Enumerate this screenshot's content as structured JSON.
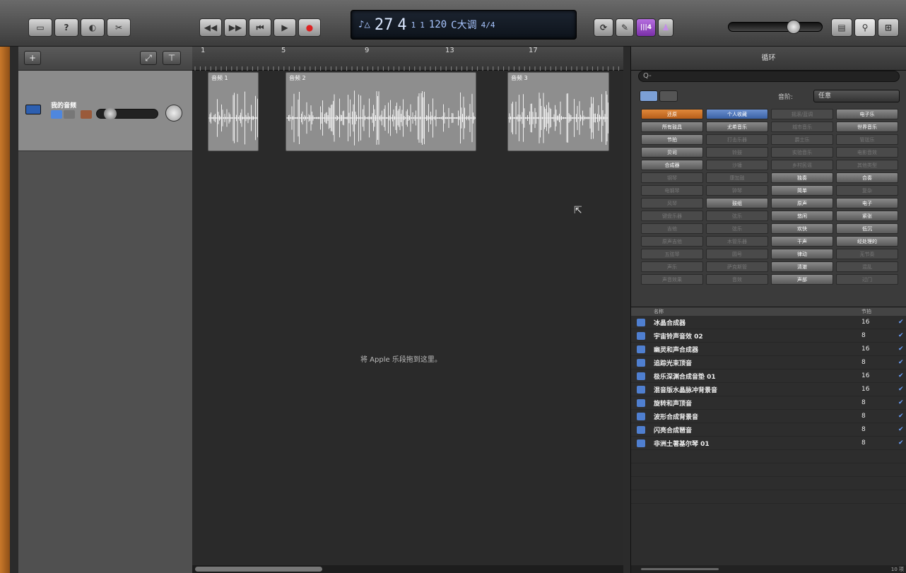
{
  "toolbar": {
    "left_buttons": [
      "▭",
      "?",
      "◐",
      "✂"
    ],
    "transport_buttons": [
      "◀◀",
      "▶▶",
      "⏮",
      "▶",
      "●"
    ],
    "lcd": {
      "bar": "27",
      "beat": "4",
      "div": "1",
      "tick": "1",
      "tempo": "120",
      "key": "C大调",
      "sig": "4/4"
    },
    "right_tools": [
      "⟳",
      "✎",
      "|||4",
      "♟"
    ],
    "right_buttons": [
      "▤",
      "⚲",
      "⊞"
    ]
  },
  "tracks": {
    "track_name": "我的音频"
  },
  "ruler": {
    "ticks": [
      "1",
      "5",
      "9",
      "13",
      "17"
    ]
  },
  "regions": [
    {
      "name": "音频 1"
    },
    {
      "name": "音频 2"
    },
    {
      "name": "音频 3"
    }
  ],
  "arrange": {
    "drop_hint": "将 Apple 乐段拖到这里。"
  },
  "browser": {
    "title": "循环",
    "search_placeholder": "Q-",
    "scale_label": "音阶:",
    "scale_value": "任意",
    "keywords": [
      {
        "label": "还原",
        "style": "orange"
      },
      {
        "label": "个人收藏",
        "style": "blue"
      },
      {
        "label": "摇滚/蓝调",
        "style": "dim"
      },
      {
        "label": "电子乐",
        "style": "lit"
      },
      {
        "label": "所有鼓具",
        "style": "lit"
      },
      {
        "label": "尤希音乐",
        "style": "lit"
      },
      {
        "label": "城市音乐",
        "style": "dim"
      },
      {
        "label": "世界音乐",
        "style": "lit"
      },
      {
        "label": "节拍",
        "style": "lit"
      },
      {
        "label": "打击乐器",
        "style": "dim"
      },
      {
        "label": "爵士乐",
        "style": "dim"
      },
      {
        "label": "管弦乐",
        "style": "dim"
      },
      {
        "label": "贝司",
        "style": "lit"
      },
      {
        "label": "铃鼓",
        "style": "dim"
      },
      {
        "label": "实验音乐",
        "style": "dim"
      },
      {
        "label": "电影音效",
        "style": "dim"
      },
      {
        "label": "合成器",
        "style": "lit"
      },
      {
        "label": "沙锤",
        "style": "dim"
      },
      {
        "label": "乡村民谣",
        "style": "dim"
      },
      {
        "label": "其他类型",
        "style": "dim"
      },
      {
        "label": "钢琴",
        "style": "dim"
      },
      {
        "label": "康加鼓",
        "style": "dim"
      },
      {
        "label": "独奏",
        "style": "lit"
      },
      {
        "label": "合奏",
        "style": "lit"
      },
      {
        "label": "电钢琴",
        "style": "dim"
      },
      {
        "label": "钟琴",
        "style": "dim"
      },
      {
        "label": "简单",
        "style": "lit"
      },
      {
        "label": "复杂",
        "style": "dim"
      },
      {
        "label": "风琴",
        "style": "dim"
      },
      {
        "label": "鼓组",
        "style": "lit"
      },
      {
        "label": "原声",
        "style": "lit"
      },
      {
        "label": "电子",
        "style": "lit"
      },
      {
        "label": "键盘乐器",
        "style": "dim"
      },
      {
        "label": "弦乐",
        "style": "dim"
      },
      {
        "label": "悠闲",
        "style": "lit"
      },
      {
        "label": "紧张",
        "style": "lit"
      },
      {
        "label": "吉他",
        "style": "dim"
      },
      {
        "label": "弦乐",
        "style": "dim"
      },
      {
        "label": "欢快",
        "style": "lit"
      },
      {
        "label": "低沉",
        "style": "lit"
      },
      {
        "label": "原声吉他",
        "style": "dim"
      },
      {
        "label": "木管乐器",
        "style": "dim"
      },
      {
        "label": "干声",
        "style": "lit"
      },
      {
        "label": "经处理的",
        "style": "lit"
      },
      {
        "label": "五弦琴",
        "style": "dim"
      },
      {
        "label": "圆号",
        "style": "dim"
      },
      {
        "label": "律动",
        "style": "lit"
      },
      {
        "label": "无节奏",
        "style": "dim"
      },
      {
        "label": "声乐",
        "style": "dim"
      },
      {
        "label": "萨克斯管",
        "style": "dim"
      },
      {
        "label": "清澈",
        "style": "lit"
      },
      {
        "label": "混乱",
        "style": "dim"
      },
      {
        "label": "声音效果",
        "style": "dim"
      },
      {
        "label": "音效",
        "style": "dim"
      },
      {
        "label": "声部",
        "style": "lit"
      },
      {
        "label": "过门",
        "style": "dim"
      }
    ],
    "results_header": {
      "name": "名称",
      "beats": "节拍"
    },
    "results": [
      {
        "name": "冰晶合成器",
        "beats": "16"
      },
      {
        "name": "宇宙铃声音效 02",
        "beats": "8"
      },
      {
        "name": "幽灵和声合成器",
        "beats": "16"
      },
      {
        "name": "追踪光束顶音",
        "beats": "8"
      },
      {
        "name": "极乐深渊合成音垫 01",
        "beats": "16"
      },
      {
        "name": "混音版水晶脉冲背景音",
        "beats": "16"
      },
      {
        "name": "旋转和声顶音",
        "beats": "8"
      },
      {
        "name": "波形合成背景音",
        "beats": "8"
      },
      {
        "name": "闪亮合成琶音",
        "beats": "8"
      },
      {
        "name": "非洲土著基尔琴 01",
        "beats": "8"
      }
    ],
    "item_count": "10 项"
  }
}
